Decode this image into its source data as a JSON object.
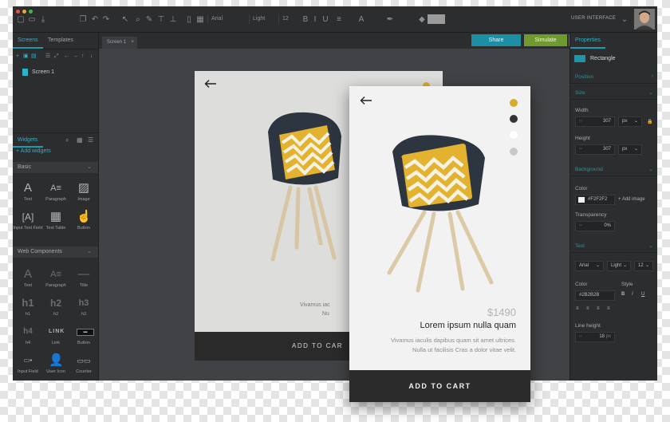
{
  "toolbar": {
    "font_family": "Arial",
    "font_weight": "Light",
    "font_size": "12",
    "workspace_label": "USER INTERFACE"
  },
  "left_panel": {
    "tabs": [
      "Screens",
      "Templates"
    ],
    "screens": [
      "Screen 1"
    ],
    "widgets_title": "Widgets",
    "add_widgets": "+ Add widgets",
    "basic_title": "Basic",
    "basic_items": [
      "Text",
      "Paragraph",
      "Image",
      "Input Text Field",
      "Text Table",
      "Button"
    ],
    "web_title": "Web Components",
    "web_items": [
      "Text",
      "Paragraph",
      "Title",
      "h1",
      "h2",
      "h3",
      "h4",
      "Link",
      "Button",
      "Input Field",
      "User Icon",
      "Counter"
    ]
  },
  "canvas": {
    "tab_label": "Screen 1",
    "share_label": "Share",
    "simulate_label": "Simulate",
    "back_screen": {
      "desc_line1": "Vivamus iac",
      "desc_line2": "Nu",
      "cart_label": "ADD TO CAR"
    },
    "card": {
      "price": "$1490",
      "title": "Lorem ipsum nulla quam",
      "desc_line1": "Vivamus iaculis dapibus quam sit amet ultrices.",
      "desc_line2": "Nulla ut facilisis Cras a dolor vitae velit.",
      "cart_label": "ADD TO CART",
      "swatch_colors": [
        "#d9ab2d",
        "#333333",
        "#ffffff",
        "#c8c8c8"
      ]
    }
  },
  "properties": {
    "tab": "Properties",
    "selected": "Rectangle",
    "position_section": "Position",
    "size_section": "Size",
    "width_label": "Width",
    "width_value": "307",
    "width_unit": "px",
    "height_label": "Height",
    "height_value": "307",
    "height_unit": "px",
    "background_section": "Background",
    "color_label": "Color",
    "color_value": "#F2F2F2",
    "add_image": "+ Add image",
    "transparency_label": "Transparency",
    "transparency_value": "0%",
    "text_section": "Text",
    "text_font": "Arial",
    "text_weight": "Light",
    "text_size": "12",
    "text_color_label": "Color",
    "text_color_value": "#2B2B2B",
    "style_label": "Style",
    "style_bold": "B",
    "style_italic": "I",
    "style_underline": "U",
    "line_height_label": "Line height",
    "line_height_value": "18",
    "line_height_unit": "px"
  },
  "colors": {
    "accent": "#2bb3c6",
    "share": "#1d8fa5",
    "simulate": "#6f9a2f",
    "chair_yellow": "#d9ab2d"
  }
}
